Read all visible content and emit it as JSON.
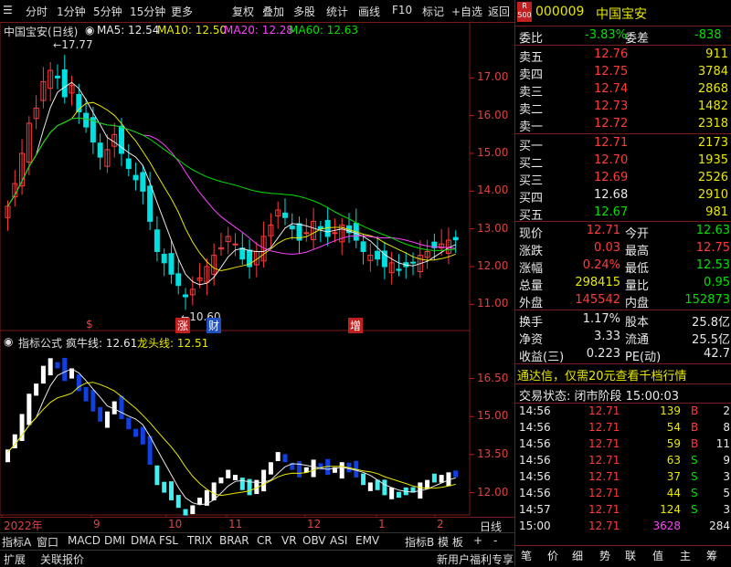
{
  "toolbar": {
    "items": [
      "分时",
      "1分钟",
      "5分钟",
      "15分钟",
      "更多",
      "复权",
      "叠加",
      "多股",
      "统计",
      "画线",
      "F10",
      "标记",
      "+自选",
      "返回"
    ]
  },
  "main_chart": {
    "title": "中国宝安(日线)",
    "ma5": "MA5: 12.54",
    "ma10": "MA10: 12.50",
    "ma20": "MA20: 12.28",
    "ma60": "MA60: 12.63",
    "high_marker": "17.77",
    "low_marker": "10.60",
    "events": [
      "$",
      "涨",
      "财",
      "增"
    ],
    "colors": {
      "ma5": "#e8e8e8",
      "ma10": "#e8e800",
      "ma20": "#ff40ff",
      "ma60": "#00e000",
      "up": "#ff3b3b",
      "down": "#00e0e0"
    }
  },
  "indicator": {
    "title": "指标公式",
    "line1": "疯牛线: 12.61",
    "line2": "龙头线: 12.51"
  },
  "chart_data": [
    {
      "type": "candlestick",
      "title": "中国宝安(日线)",
      "yticks": [
        11.0,
        12.0,
        13.0,
        14.0,
        15.0,
        16.0,
        17.0
      ],
      "ylim": [
        10.5,
        18.0
      ],
      "x_ticks": [
        "2022年",
        "9",
        "10",
        "11",
        "12",
        "1",
        "2"
      ],
      "close": [
        13.6,
        14.2,
        15.0,
        15.8,
        16.2,
        16.9,
        17.2,
        17.0,
        16.5,
        16.8,
        16.1,
        15.7,
        15.3,
        14.9,
        15.1,
        15.5,
        15.0,
        14.6,
        14.3,
        14.0,
        13.2,
        12.4,
        12.1,
        11.8,
        11.5,
        11.2,
        11.4,
        11.7,
        12.0,
        12.3,
        12.5,
        12.8,
        12.6,
        12.2,
        12.0,
        12.4,
        12.8,
        13.1,
        13.5,
        13.3,
        13.0,
        12.7,
        12.9,
        13.2,
        13.0,
        12.8,
        12.9,
        13.1,
        12.9,
        12.7,
        12.4,
        12.3,
        12.2,
        12.0,
        12.1,
        11.9,
        12.0,
        12.1,
        12.3,
        12.4,
        12.5,
        12.6,
        12.7,
        12.71
      ],
      "ma5_last": 12.54,
      "ma10_last": 12.5,
      "ma20_last": 12.28,
      "ma60_last": 12.63,
      "annotations": [
        "17.77",
        "10.60"
      ]
    },
    {
      "type": "line",
      "title": "指标公式",
      "yticks": [
        12.0,
        13.5,
        15.0,
        16.5
      ],
      "series": [
        {
          "name": "疯牛线",
          "last": 12.61
        },
        {
          "name": "龙头线",
          "last": 12.51
        }
      ]
    }
  ],
  "bottom_tabs": [
    "指标A",
    "窗口",
    "MACD",
    "DMI",
    "DMA",
    "FSL",
    "TRIX",
    "BRAR",
    "CR",
    "VR",
    "OBV",
    "ASI",
    "EMV",
    "指标B",
    "模 板",
    "+",
    "-"
  ],
  "bottom_row": [
    "扩展",
    "关联报价",
    "新用户福利专享"
  ],
  "period_label": "日线",
  "quote": {
    "badge": "R\n500",
    "code": "000009",
    "name": "中国宝安",
    "weibi_label": "委比",
    "weibi": "-3.83%",
    "weicha_label": "委差",
    "weicha": "-838",
    "sell": [
      {
        "label": "卖五",
        "price": "12.76",
        "vol": "911"
      },
      {
        "label": "卖四",
        "price": "12.75",
        "vol": "3784"
      },
      {
        "label": "卖三",
        "price": "12.74",
        "vol": "2868"
      },
      {
        "label": "卖二",
        "price": "12.73",
        "vol": "1482"
      },
      {
        "label": "卖一",
        "price": "12.72",
        "vol": "2318"
      }
    ],
    "buy": [
      {
        "label": "买一",
        "price": "12.71",
        "vol": "2173"
      },
      {
        "label": "买二",
        "price": "12.70",
        "vol": "1935"
      },
      {
        "label": "买三",
        "price": "12.69",
        "vol": "2526"
      },
      {
        "label": "买四",
        "price": "12.68",
        "vol": "2910"
      },
      {
        "label": "买五",
        "price": "12.67",
        "vol": "981"
      }
    ],
    "stats": [
      {
        "l1": "现价",
        "v1": "12.71",
        "l2": "今开",
        "v2": "12.63"
      },
      {
        "l1": "涨跌",
        "v1": "0.03",
        "l2": "最高",
        "v2": "12.75"
      },
      {
        "l1": "涨幅",
        "v1": "0.24%",
        "l2": "最低",
        "v2": "12.53"
      },
      {
        "l1": "总量",
        "v1": "298415",
        "l2": "量比",
        "v2": "0.95"
      },
      {
        "l1": "外盘",
        "v1": "145542",
        "l2": "内盘",
        "v2": "152873"
      }
    ],
    "stats2": [
      {
        "l1": "换手",
        "v1": "1.17%",
        "l2": "股本",
        "v2": "25.8亿"
      },
      {
        "l1": "净资",
        "v1": "3.33",
        "l2": "流通",
        "v2": "25.5亿"
      },
      {
        "l1": "收益(三)",
        "v1": "0.223",
        "l2": "PE(动)",
        "v2": "42.7"
      }
    ],
    "promo": "通达信，仅需20元查看千档行情",
    "status": "交易状态: 闭市阶段 15:00:03",
    "ticks": [
      {
        "time": "14:56",
        "price": "12.71",
        "vol": "139",
        "bs": "B",
        "n": "2"
      },
      {
        "time": "14:56",
        "price": "12.71",
        "vol": "54",
        "bs": "B",
        "n": "8"
      },
      {
        "time": "14:56",
        "price": "12.71",
        "vol": "59",
        "bs": "B",
        "n": "11"
      },
      {
        "time": "14:56",
        "price": "12.71",
        "vol": "63",
        "bs": "S",
        "n": "9"
      },
      {
        "time": "14:56",
        "price": "12.71",
        "vol": "37",
        "bs": "S",
        "n": "3"
      },
      {
        "time": "14:56",
        "price": "12.71",
        "vol": "44",
        "bs": "S",
        "n": "5"
      },
      {
        "time": "14:57",
        "price": "12.71",
        "vol": "124",
        "bs": "S",
        "n": "3"
      },
      {
        "time": "15:00",
        "price": "12.71",
        "vol": "3628",
        "bs": "",
        "n": "284"
      }
    ],
    "bottom_tabs": [
      "笔",
      "价",
      "细",
      "势",
      "联",
      "值",
      "主",
      "筹"
    ]
  }
}
